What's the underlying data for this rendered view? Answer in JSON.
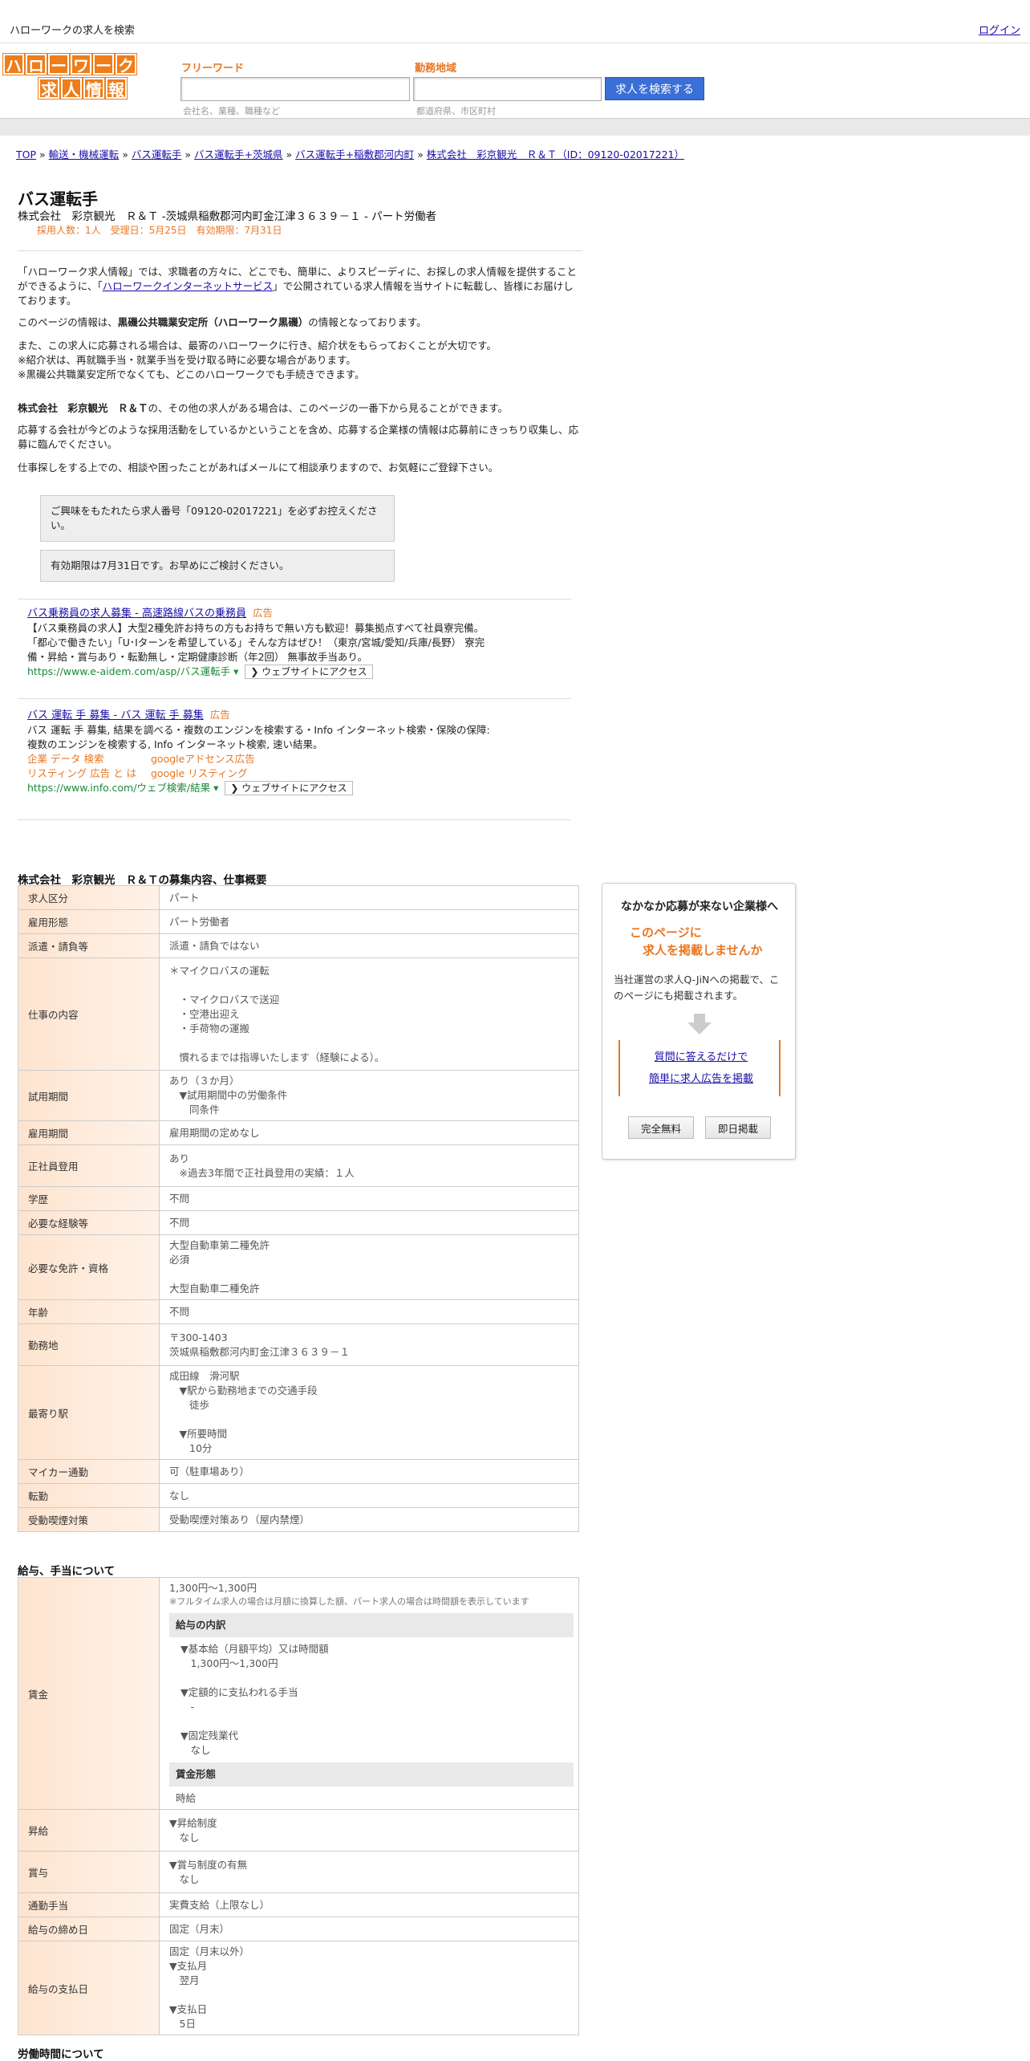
{
  "topbar": {
    "title": "ハローワークの求人を検索",
    "login": "ログイン"
  },
  "logo": {
    "row1": [
      "ハ",
      "ロ",
      "ー",
      "ワ",
      "ー",
      "ク"
    ],
    "row2": [
      "求",
      "人",
      "情",
      "報"
    ]
  },
  "search": {
    "keyword_label": "フリーワード",
    "keyword_hint": "会社名、業種、職種など",
    "area_label": "勤務地域",
    "area_hint": "都道府県、市区町村",
    "button": "求人を検索する"
  },
  "breadcrumb": [
    "TOP",
    "輸送・機械運転",
    "バス運転手",
    "バス運転手+茨城県",
    "バス運転手+稲敷郡河内町",
    "株式会社　彩京観光　Ｒ＆Ｔ（ID：09120-02017221）"
  ],
  "job": {
    "title": "バス運転手",
    "subtitle": "株式会社　彩京観光　Ｒ＆Ｔ -茨城県稲敷郡河内町金江津３６３９－１ - パート労働者",
    "meta": "採用人数：1人　受理日：5月25日　有効期限：7月31日"
  },
  "intro": {
    "p1a": "「ハローワーク求人情報」では、求職者の方々に、どこでも、簡単に、よりスピーディに、お探しの求人情報を提供することができるように、「",
    "p1link": "ハローワークインターネットサービス",
    "p1b": "」で公開されている求人情報を当サイトに転載し、皆様にお届けしております。",
    "p2a": "このページの情報は、",
    "p2b": "黒磯公共職業安定所（ハローワーク黒磯）",
    "p2c": "の情報となっております。",
    "p3l1": "また、この求人に応募される場合は、最寄のハローワークに行き、紹介状をもらっておくことが大切です。",
    "p3l2": "※紹介状は、再就職手当・就業手当を受け取る時に必要な場合があります。",
    "p3l3": "※黒磯公共職業安定所でなくても、どこのハローワークでも手続きできます。",
    "p4a": "株式会社　彩京観光　Ｒ＆Ｔ",
    "p4b": "の、その他の求人がある場合は、このページの一番下から見ることができます。",
    "p5": "応募する会社が今どのような採用活動をしているかということを含め、応募する企業様の情報は応募前にきっちり収集し、応募に臨んでください。",
    "p6": "仕事探しをする上での、相談や困ったことがあればメールにて相談承りますので、お気軽にご登録下さい。"
  },
  "notes": {
    "n1": "ご興味をもたれたら求人番号「09120-02017221」を必ずお控えください。",
    "n2": "有効期限は7月31日です。お早めにご検討ください。"
  },
  "ads": [
    {
      "title": "バス乗務員の求人募集 - 高速路線バスの乗務員",
      "tag": "広告",
      "body1": "【バス乗務員の求人】大型2種免許お持ちの方もお持ちで無い方も歓迎！募集拠点すべて社員寮完備。",
      "body2": "「都心で働きたい」「U･Iターンを希望している」そんな方はぜひ！（東京/宮城/愛知/兵庫/長野） 寮完",
      "body3": "備・昇給・賞与あり・転勤無し・定期健康診断（年2回） 無事故手当あり。",
      "url": "https://www.e-aidem.com/asp/バス運転手",
      "visit": "ウェブサイトにアクセス"
    },
    {
      "title": "バス 運転 手 募集 - バス 運転 手 募集",
      "tag": "広告",
      "body1": "バス 運転 手 募集, 結果を調べる・複数のエンジンを検索する・Info インターネット検索・保険の保障:",
      "body2": "複数のエンジンを検索する, Info インターネット検索, 速い結果。",
      "links": [
        "企業 データ 検索",
        "googleアドセンス広告",
        "リスティング 広告 と は",
        "google リスティング"
      ],
      "url": "https://www.info.com/ウェブ検索/結果",
      "visit": "ウェブサイトにアクセス"
    }
  ],
  "details": {
    "title": "株式会社　彩京観光　Ｒ＆Ｔの募集内容、仕事概要",
    "rows": [
      {
        "k": "求人区分",
        "v": [
          "パート"
        ]
      },
      {
        "k": "雇用形態",
        "v": [
          "パート労働者"
        ]
      },
      {
        "k": "派遣・請負等",
        "v": [
          "派遣・請負ではない"
        ]
      },
      {
        "k": "仕事の内容",
        "v": [
          "＊マイクロバスの運転",
          "",
          "　・マイクロバスで送迎",
          "　・空港出迎え",
          "　・手荷物の運搬",
          "",
          "　慣れるまでは指導いたします（経験による）。"
        ]
      },
      {
        "k": "試用期間",
        "v": [
          "あり（３か月）",
          "　▼試用期間中の労働条件",
          "　　同条件"
        ]
      },
      {
        "k": "雇用期間",
        "v": [
          "雇用期間の定めなし"
        ]
      },
      {
        "k": "正社員登用",
        "v": [
          "あり",
          "　※過去3年間で正社員登用の実績：１人"
        ]
      },
      {
        "k": "学歴",
        "v": [
          "不問"
        ]
      },
      {
        "k": "必要な経験等",
        "v": [
          "不問"
        ]
      },
      {
        "k": "必要な免許・資格",
        "v": [
          "大型自動車第二種免許",
          "必須",
          "",
          "大型自動車二種免許"
        ]
      },
      {
        "k": "年齢",
        "v": [
          "不問"
        ]
      },
      {
        "k": "勤務地",
        "v": [
          "〒300-1403",
          "茨城県稲敷郡河内町金江津３６３９－１"
        ]
      },
      {
        "k": "最寄り駅",
        "v": [
          "成田線　滑河駅",
          "　▼駅から勤務地までの交通手段",
          "　　徒歩",
          "",
          "　▼所要時間",
          "　　10分"
        ]
      },
      {
        "k": "マイカー通勤",
        "v": [
          "可（駐車場あり）"
        ]
      },
      {
        "k": "転勤",
        "v": [
          "なし"
        ]
      },
      {
        "k": "受動喫煙対策",
        "v": [
          "受動喫煙対策あり（屋内禁煙）"
        ]
      }
    ]
  },
  "salary": {
    "title": "給与、手当について",
    "wage_key": "賃金",
    "wage_line1": "1,300円〜1,300円",
    "wage_note": "※フルタイム求人の場合は月額に換算した額、パート求人の場合は時間額を表示しています",
    "breakdown_title": "給与の内訳",
    "breakdown": [
      "▼基本給（月額平均）又は時間額",
      "　1,300円〜1,300円",
      "",
      "▼定額的に支払われる手当",
      "　-",
      "",
      "▼固定残業代",
      "　なし"
    ],
    "form_title": "賃金形態",
    "form_value": "時給",
    "rows": [
      {
        "k": "昇給",
        "v": [
          "▼昇給制度",
          "　なし"
        ]
      },
      {
        "k": "賞与",
        "v": [
          "▼賞与制度の有無",
          "　なし"
        ]
      },
      {
        "k": "通勤手当",
        "v": [
          "実費支給（上限なし）"
        ]
      },
      {
        "k": "給与の締め日",
        "v": [
          "固定（月末）"
        ]
      },
      {
        "k": "給与の支払日",
        "v": [
          "固定（月末以外）",
          "▼支払月",
          "　翌月",
          "",
          "▼支払日",
          "　5日"
        ]
      }
    ]
  },
  "worktime": {
    "title": "労働時間について"
  },
  "sidebox": {
    "heading": "なかなか応募が来ない企業様へ",
    "offer1": "このページに",
    "offer2": "求人を掲載しませんか",
    "desc": "当社運営の求人Q-JiNへの掲載で、このページにも掲載されます。",
    "link1": "質問に答えるだけで",
    "link2": "簡単に求人広告を掲載",
    "btn1": "完全無料",
    "btn2": "即日掲載"
  },
  "colors": {
    "accent": "#e87722",
    "link": "#1a0dab",
    "button": "#3a6fd8",
    "url": "#1b8a3a"
  }
}
